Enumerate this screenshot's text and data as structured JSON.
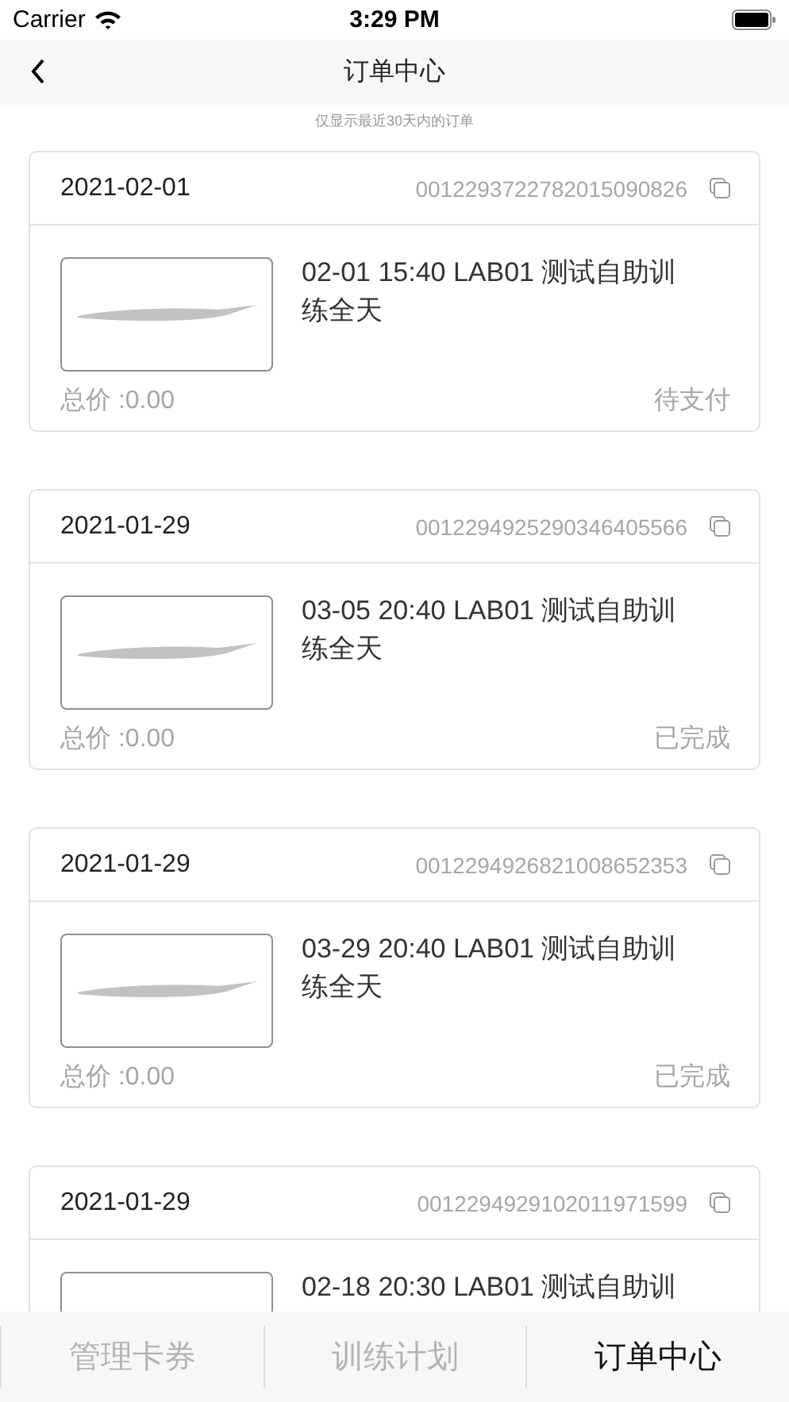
{
  "status_bar": {
    "carrier": "Carrier",
    "time": "3:29 PM"
  },
  "nav": {
    "title": "订单中心"
  },
  "notice": "仅显示最近30天内的订单",
  "orders": [
    {
      "date": "2021-02-01",
      "order_no": "0012293722782015090826",
      "title": "02-01 15:40 LAB01 测试自助训练全天",
      "total": "总价 :0.00",
      "status": "待支付"
    },
    {
      "date": "2021-01-29",
      "order_no": "0012294925290346405566",
      "title": "03-05 20:40 LAB01 测试自助训练全天",
      "total": "总价 :0.00",
      "status": "已完成"
    },
    {
      "date": "2021-01-29",
      "order_no": "0012294926821008652353",
      "title": "03-29 20:40 LAB01 测试自助训练全天",
      "total": "总价 :0.00",
      "status": "已完成"
    },
    {
      "date": "2021-01-29",
      "order_no": "0012294929102011971599",
      "title": "02-18 20:30 LAB01 测试自助训"
    }
  ],
  "tabs": [
    {
      "label": "管理卡券",
      "selected": false
    },
    {
      "label": "训练计划",
      "selected": false
    },
    {
      "label": "订单中心",
      "selected": true
    }
  ]
}
